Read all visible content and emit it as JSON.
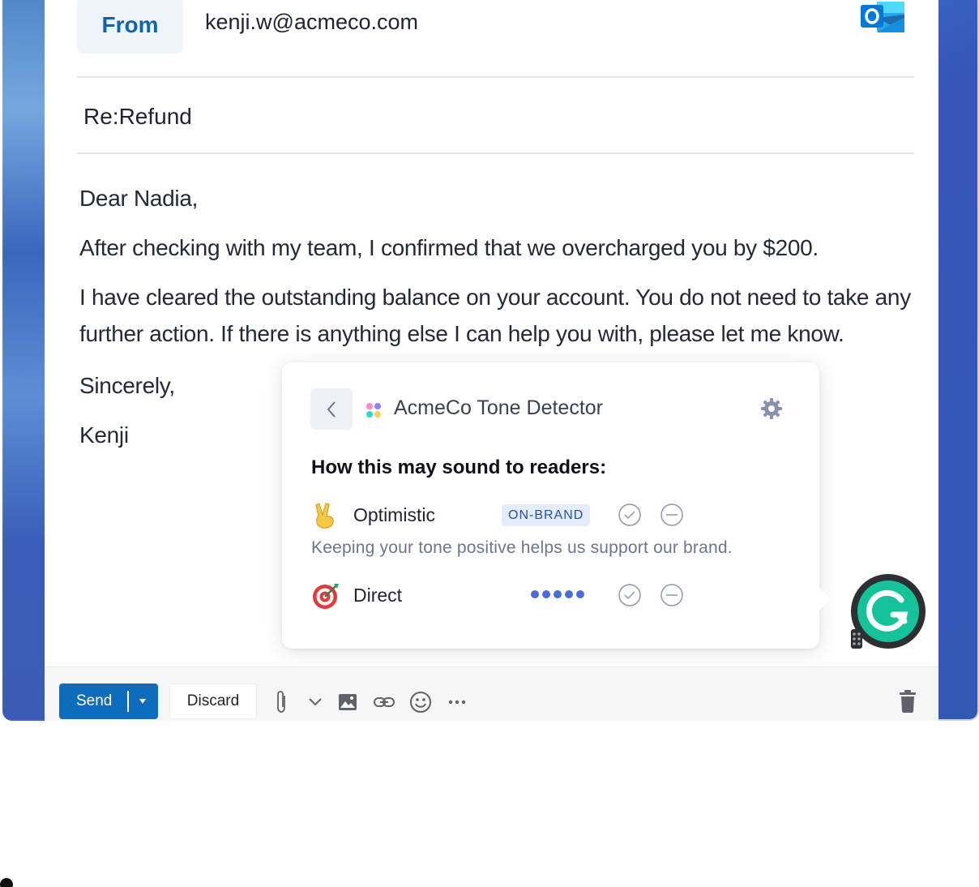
{
  "compose": {
    "from_label": "From",
    "from_email": "kenji.w@acmeco.com",
    "subject": "Re:Refund",
    "body": {
      "greeting": "Dear Nadia,",
      "line1": "After checking with my team, I confirmed that we overcharged you by $200.",
      "line2": "I have cleared the outstanding balance on your account. You do not need to take any further action. If there is anything else I can help you with, please let me know.",
      "closing": "Sincerely,",
      "signature": "Kenji"
    }
  },
  "tone_detector": {
    "title": "AcmeCo Tone Detector",
    "heading": "How this may sound to readers:",
    "tones": [
      {
        "emoji": "victory-hand-icon",
        "label": "Optimistic",
        "badge": "ON-BRAND",
        "description": "Keeping your tone positive helps us support our brand."
      },
      {
        "emoji": "direct-hit-icon",
        "label": "Direct",
        "intensity_dots": 5
      }
    ]
  },
  "toolbar": {
    "send_label": "Send",
    "discard_label": "Discard",
    "icons": [
      "paperclip-icon",
      "chevron-down-icon",
      "image-icon",
      "link-icon",
      "emoji-icon",
      "more-icon",
      "trash-icon"
    ]
  },
  "colors": {
    "accent_blue": "#0f6cbd",
    "from_blue": "#0e65ae",
    "badge_bg": "#e3ecfb",
    "dot_blue": "#4a6cd9",
    "grammarly_green": "#15c39a"
  }
}
